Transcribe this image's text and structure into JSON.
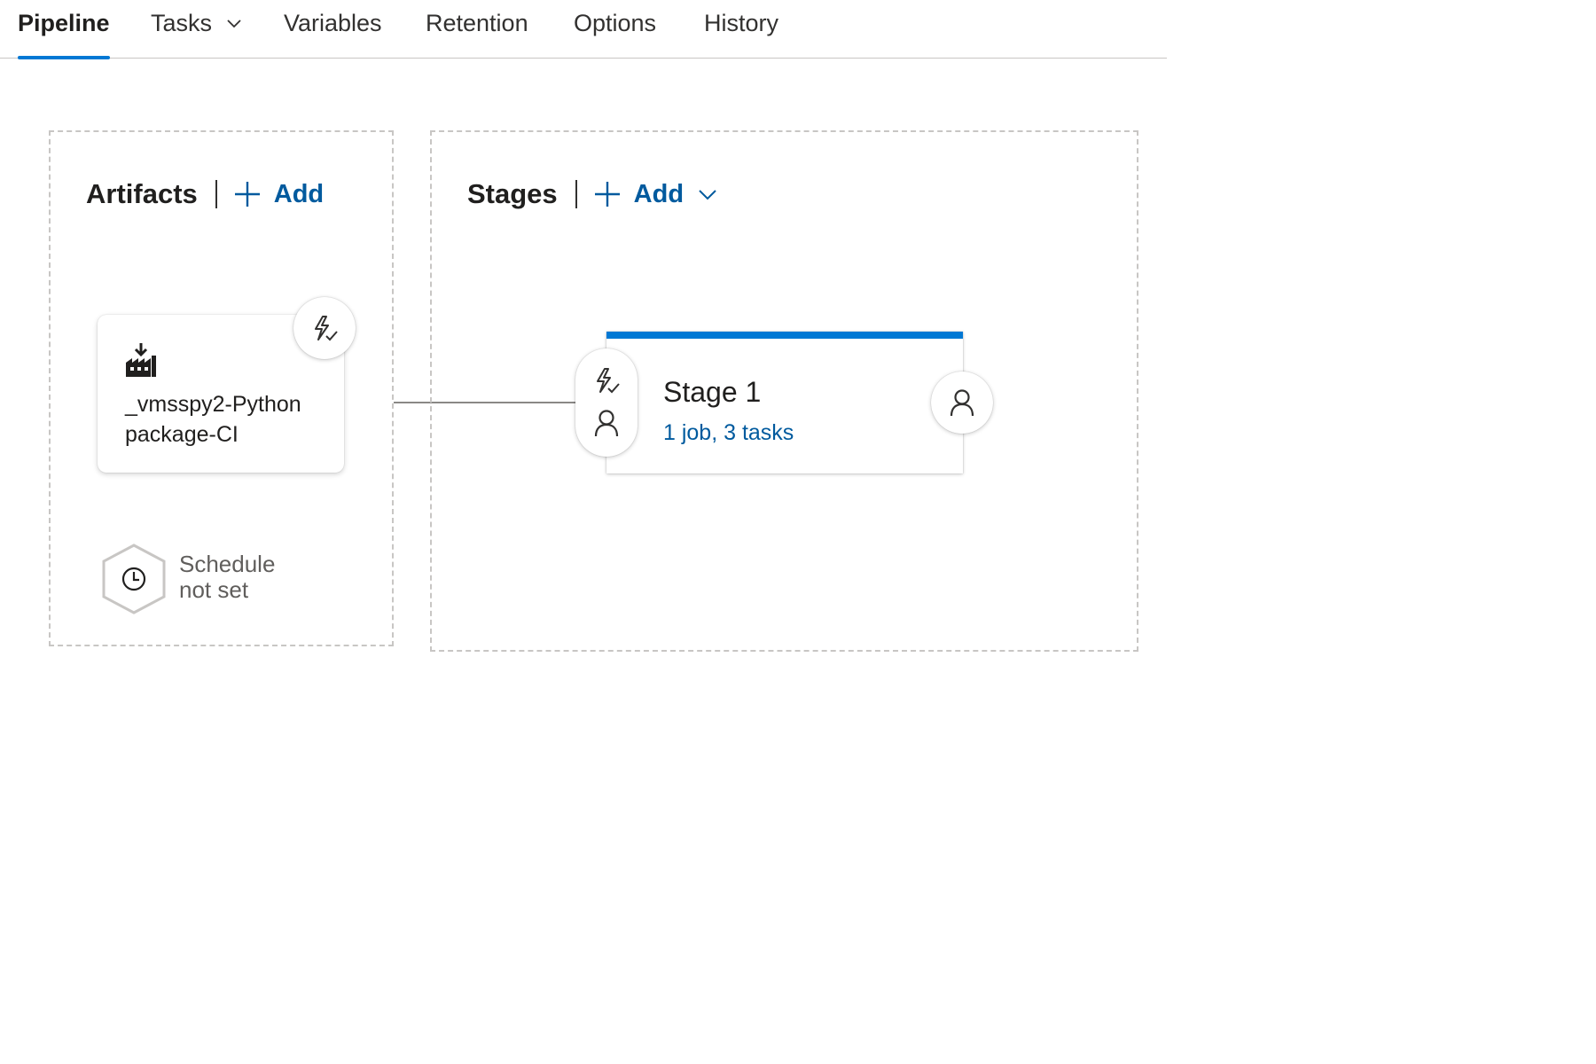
{
  "tabs": [
    {
      "label": "Pipeline",
      "active": true
    },
    {
      "label": "Tasks",
      "has_dropdown": true
    },
    {
      "label": "Variables"
    },
    {
      "label": "Retention"
    },
    {
      "label": "Options"
    },
    {
      "label": "History"
    }
  ],
  "artifacts": {
    "title": "Artifacts",
    "add_label": "Add",
    "items": [
      {
        "name": "_vmsspy2-Python package-CI",
        "icon": "build-artifact-icon",
        "trigger_icon": "lightning-trigger-icon"
      }
    ],
    "schedule": {
      "label": "Schedule not set",
      "icon": "clock-icon"
    }
  },
  "stages": {
    "title": "Stages",
    "add_label": "Add",
    "items": [
      {
        "name": "Stage 1",
        "summary": "1 job, 3 tasks",
        "pre_icons": [
          "lightning-trigger-icon",
          "person-icon"
        ],
        "post_icon": "person-icon"
      }
    ]
  },
  "colors": {
    "accent": "#0078d4",
    "link": "#005a9e",
    "border_dashed": "#c8c6c4",
    "muted_text": "#605e5c"
  }
}
